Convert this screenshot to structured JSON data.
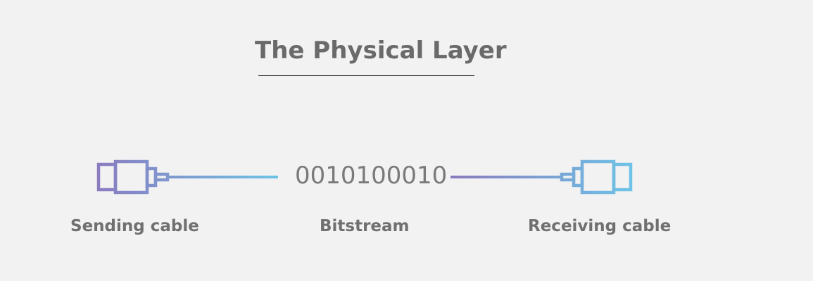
{
  "title": "The Physical Layer",
  "bitstream": {
    "value": "0010100010",
    "label": "Bitstream"
  },
  "sending": {
    "label": "Sending cable",
    "icon": "cable-plug-icon"
  },
  "receiving": {
    "label": "Receiving cable",
    "icon": "cable-plug-icon"
  },
  "colors": {
    "background": "#f2f2f2",
    "gradient_start": "#8a7bbf",
    "gradient_end": "#6ec3e6",
    "text": "#707070"
  }
}
